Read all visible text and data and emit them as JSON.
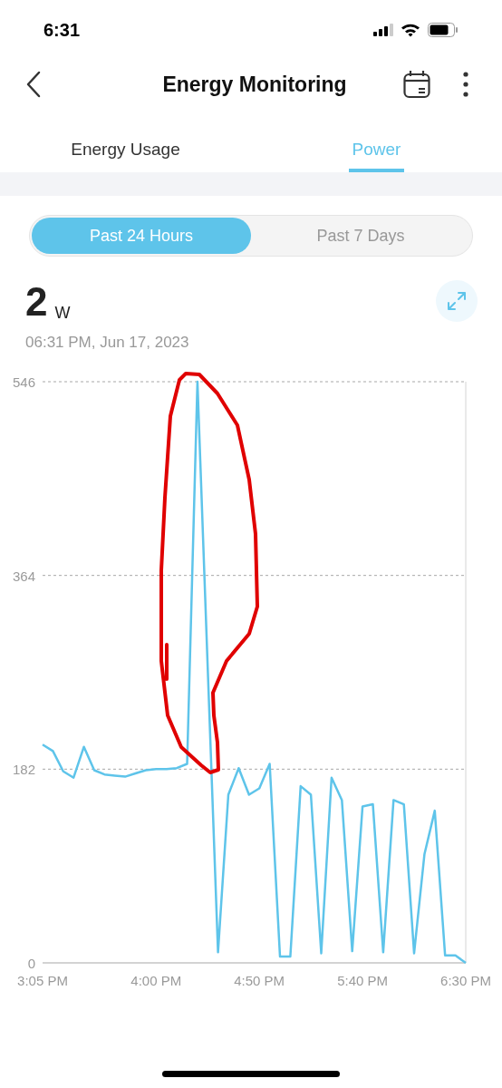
{
  "status_bar": {
    "time": "6:31"
  },
  "header": {
    "title": "Energy Monitoring"
  },
  "tabs": [
    {
      "label": "Energy Usage",
      "selected": false
    },
    {
      "label": "Power",
      "selected": true
    }
  ],
  "range_toggle": [
    {
      "label": "Past 24 Hours",
      "selected": true
    },
    {
      "label": "Past 7 Days",
      "selected": false
    }
  ],
  "reading": {
    "value": "2",
    "unit": "W",
    "timestamp": "06:31 PM, Jun 17, 2023"
  },
  "chart_data": {
    "type": "line",
    "categories": [
      "3:05 PM",
      null,
      null,
      null,
      null,
      null,
      null,
      null,
      null,
      null,
      null,
      "4:00 PM",
      null,
      null,
      null,
      null,
      null,
      null,
      null,
      null,
      null,
      "4:50 PM",
      null,
      null,
      null,
      null,
      null,
      null,
      null,
      null,
      null,
      "5:40 PM",
      null,
      null,
      null,
      null,
      null,
      null,
      null,
      null,
      null,
      "6:30 PM"
    ],
    "series": [
      {
        "color": "#5ec4ea",
        "values": [
          205,
          199,
          180,
          174,
          203,
          181,
          177,
          176,
          175,
          178,
          181,
          182,
          182,
          183,
          187,
          546,
          278,
          10,
          158,
          183,
          158,
          164,
          187,
          6,
          6,
          166,
          158,
          9,
          174,
          153,
          11,
          147,
          149,
          10,
          153,
          149,
          9,
          102,
          143,
          7,
          7,
          0
        ]
      }
    ],
    "ylim": [
      0,
      546
    ],
    "yticks": [
      0,
      182,
      364,
      546
    ]
  }
}
